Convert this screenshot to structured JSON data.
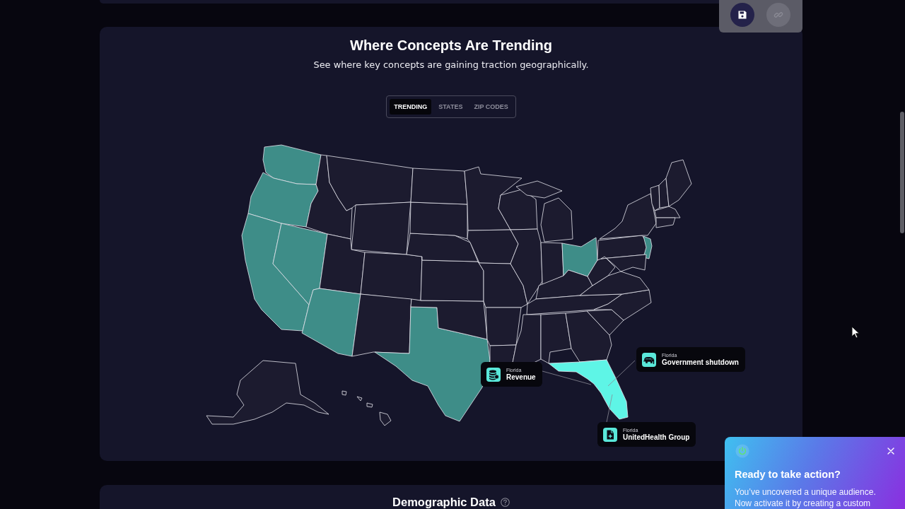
{
  "toolbar": {
    "buttons": [
      {
        "kind": "save",
        "disabled": false
      },
      {
        "kind": "link",
        "disabled": true
      }
    ]
  },
  "trending_section": {
    "title": "Where Concepts Are Trending",
    "subtitle": "See where key concepts are gaining traction geographically.",
    "tabs": [
      {
        "label": "TRENDING",
        "selected": true
      },
      {
        "label": "STATES",
        "selected": false
      },
      {
        "label": "ZIP CODES",
        "selected": false
      }
    ],
    "map": {
      "callouts": [
        {
          "kind": "finance",
          "region": "Florida",
          "label": "Revenue"
        },
        {
          "kind": "politics",
          "region": "Florida",
          "label": "Government shutdown"
        },
        {
          "kind": "health",
          "region": "Florida",
          "label": "UnitedHealth Group"
        }
      ]
    }
  },
  "demographic_section": {
    "title": "Demographic Data"
  },
  "popup": {
    "title": "Ready to take action?",
    "body": "You’ve uncovered a unique audience. Now activate it by creating a custom"
  }
}
